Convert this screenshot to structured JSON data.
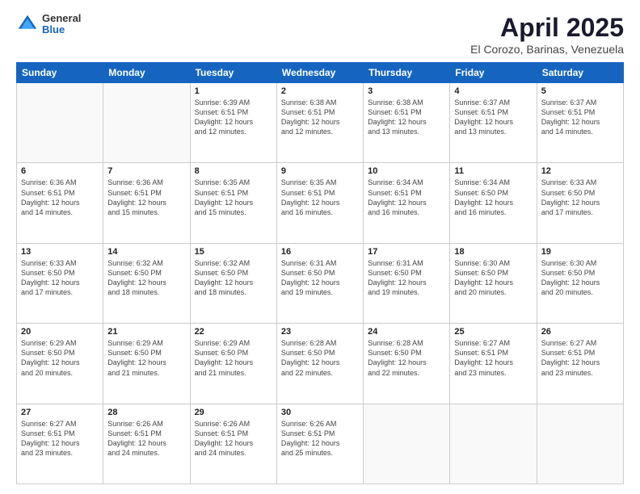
{
  "logo": {
    "general": "General",
    "blue": "Blue"
  },
  "title": {
    "month": "April 2025",
    "location": "El Corozo, Barinas, Venezuela"
  },
  "days_of_week": [
    "Sunday",
    "Monday",
    "Tuesday",
    "Wednesday",
    "Thursday",
    "Friday",
    "Saturday"
  ],
  "weeks": [
    [
      {
        "day": "",
        "info": ""
      },
      {
        "day": "",
        "info": ""
      },
      {
        "day": "1",
        "info": "Sunrise: 6:39 AM\nSunset: 6:51 PM\nDaylight: 12 hours\nand 12 minutes."
      },
      {
        "day": "2",
        "info": "Sunrise: 6:38 AM\nSunset: 6:51 PM\nDaylight: 12 hours\nand 12 minutes."
      },
      {
        "day": "3",
        "info": "Sunrise: 6:38 AM\nSunset: 6:51 PM\nDaylight: 12 hours\nand 13 minutes."
      },
      {
        "day": "4",
        "info": "Sunrise: 6:37 AM\nSunset: 6:51 PM\nDaylight: 12 hours\nand 13 minutes."
      },
      {
        "day": "5",
        "info": "Sunrise: 6:37 AM\nSunset: 6:51 PM\nDaylight: 12 hours\nand 14 minutes."
      }
    ],
    [
      {
        "day": "6",
        "info": "Sunrise: 6:36 AM\nSunset: 6:51 PM\nDaylight: 12 hours\nand 14 minutes."
      },
      {
        "day": "7",
        "info": "Sunrise: 6:36 AM\nSunset: 6:51 PM\nDaylight: 12 hours\nand 15 minutes."
      },
      {
        "day": "8",
        "info": "Sunrise: 6:35 AM\nSunset: 6:51 PM\nDaylight: 12 hours\nand 15 minutes."
      },
      {
        "day": "9",
        "info": "Sunrise: 6:35 AM\nSunset: 6:51 PM\nDaylight: 12 hours\nand 16 minutes."
      },
      {
        "day": "10",
        "info": "Sunrise: 6:34 AM\nSunset: 6:51 PM\nDaylight: 12 hours\nand 16 minutes."
      },
      {
        "day": "11",
        "info": "Sunrise: 6:34 AM\nSunset: 6:50 PM\nDaylight: 12 hours\nand 16 minutes."
      },
      {
        "day": "12",
        "info": "Sunrise: 6:33 AM\nSunset: 6:50 PM\nDaylight: 12 hours\nand 17 minutes."
      }
    ],
    [
      {
        "day": "13",
        "info": "Sunrise: 6:33 AM\nSunset: 6:50 PM\nDaylight: 12 hours\nand 17 minutes."
      },
      {
        "day": "14",
        "info": "Sunrise: 6:32 AM\nSunset: 6:50 PM\nDaylight: 12 hours\nand 18 minutes."
      },
      {
        "day": "15",
        "info": "Sunrise: 6:32 AM\nSunset: 6:50 PM\nDaylight: 12 hours\nand 18 minutes."
      },
      {
        "day": "16",
        "info": "Sunrise: 6:31 AM\nSunset: 6:50 PM\nDaylight: 12 hours\nand 19 minutes."
      },
      {
        "day": "17",
        "info": "Sunrise: 6:31 AM\nSunset: 6:50 PM\nDaylight: 12 hours\nand 19 minutes."
      },
      {
        "day": "18",
        "info": "Sunrise: 6:30 AM\nSunset: 6:50 PM\nDaylight: 12 hours\nand 20 minutes."
      },
      {
        "day": "19",
        "info": "Sunrise: 6:30 AM\nSunset: 6:50 PM\nDaylight: 12 hours\nand 20 minutes."
      }
    ],
    [
      {
        "day": "20",
        "info": "Sunrise: 6:29 AM\nSunset: 6:50 PM\nDaylight: 12 hours\nand 20 minutes."
      },
      {
        "day": "21",
        "info": "Sunrise: 6:29 AM\nSunset: 6:50 PM\nDaylight: 12 hours\nand 21 minutes."
      },
      {
        "day": "22",
        "info": "Sunrise: 6:29 AM\nSunset: 6:50 PM\nDaylight: 12 hours\nand 21 minutes."
      },
      {
        "day": "23",
        "info": "Sunrise: 6:28 AM\nSunset: 6:50 PM\nDaylight: 12 hours\nand 22 minutes."
      },
      {
        "day": "24",
        "info": "Sunrise: 6:28 AM\nSunset: 6:50 PM\nDaylight: 12 hours\nand 22 minutes."
      },
      {
        "day": "25",
        "info": "Sunrise: 6:27 AM\nSunset: 6:51 PM\nDaylight: 12 hours\nand 23 minutes."
      },
      {
        "day": "26",
        "info": "Sunrise: 6:27 AM\nSunset: 6:51 PM\nDaylight: 12 hours\nand 23 minutes."
      }
    ],
    [
      {
        "day": "27",
        "info": "Sunrise: 6:27 AM\nSunset: 6:51 PM\nDaylight: 12 hours\nand 23 minutes."
      },
      {
        "day": "28",
        "info": "Sunrise: 6:26 AM\nSunset: 6:51 PM\nDaylight: 12 hours\nand 24 minutes."
      },
      {
        "day": "29",
        "info": "Sunrise: 6:26 AM\nSunset: 6:51 PM\nDaylight: 12 hours\nand 24 minutes."
      },
      {
        "day": "30",
        "info": "Sunrise: 6:26 AM\nSunset: 6:51 PM\nDaylight: 12 hours\nand 25 minutes."
      },
      {
        "day": "",
        "info": ""
      },
      {
        "day": "",
        "info": ""
      },
      {
        "day": "",
        "info": ""
      }
    ]
  ]
}
